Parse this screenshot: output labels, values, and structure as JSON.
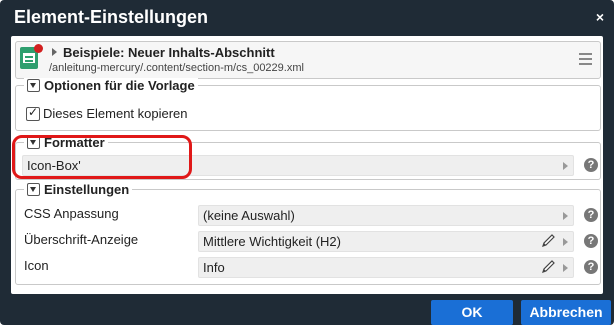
{
  "dialog": {
    "title": "Element-Einstellungen",
    "close_label": "×"
  },
  "header": {
    "title": "Beispiele: Neuer Inhalts-Abschnitt",
    "path": "/anleitung-mercury/.content/section-m/cs_00229.xml"
  },
  "template_options": {
    "legend": "Optionen für die Vorlage",
    "copy_checkbox_label": "Dieses Element kopieren",
    "copy_checked": true
  },
  "formatter": {
    "legend": "Formatter",
    "value": "Icon-Box'",
    "help": "?"
  },
  "settings": {
    "legend": "Einstellungen",
    "rows": [
      {
        "label": "CSS Anpassung",
        "value": "(keine Auswahl)",
        "help": "?"
      },
      {
        "label": "Überschrift-Anzeige",
        "value": "Mittlere Wichtigkeit (H2)",
        "help": "?"
      },
      {
        "label": "Icon",
        "value": "Info",
        "help": "?"
      }
    ]
  },
  "footer": {
    "ok_label": "OK",
    "cancel_label": "Abbrechen"
  },
  "colors": {
    "titlebar": "#1f2b36",
    "button": "#1a6fd6",
    "highlight": "#e01818"
  }
}
